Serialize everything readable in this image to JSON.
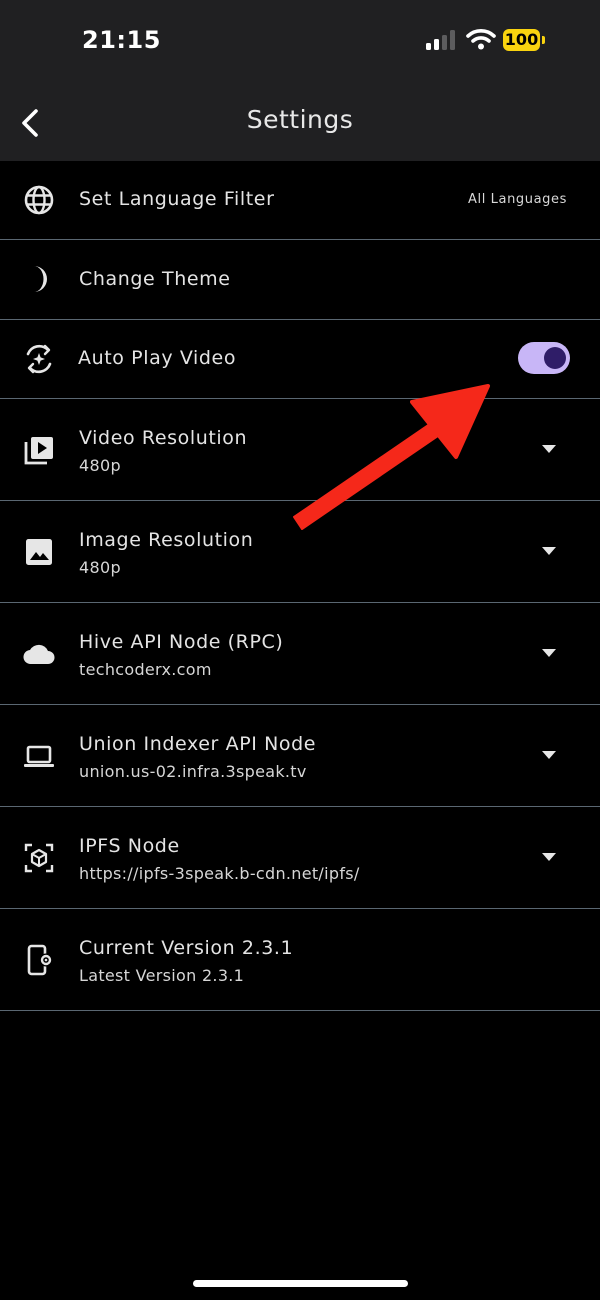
{
  "status_bar": {
    "time": "21:15",
    "battery": "100",
    "battery_color": "#F9D30F"
  },
  "app_bar": {
    "title": "Settings",
    "back_icon": "chevron-left-icon"
  },
  "settings": [
    {
      "icon": "globe-icon",
      "title": "Set Language Filter",
      "value": "All Languages"
    },
    {
      "icon": "moon-icon",
      "title": "Change Theme"
    },
    {
      "icon": "auto-play-icon",
      "title": "Auto Play Video",
      "toggle_on": true
    },
    {
      "icon": "video-library-icon",
      "title": "Video Resolution",
      "subtitle": "480p",
      "dropdown": true
    },
    {
      "icon": "image-icon",
      "title": "Image Resolution",
      "subtitle": "480p",
      "dropdown": true
    },
    {
      "icon": "cloud-icon",
      "title": "Hive API Node (RPC)",
      "subtitle": "techcoderx.com",
      "dropdown": true
    },
    {
      "icon": "laptop-icon",
      "title": "Union Indexer API Node",
      "subtitle": "union.us-02.infra.3speak.tv",
      "dropdown": true
    },
    {
      "icon": "cube-scan-icon",
      "title": "IPFS Node",
      "subtitle": "https://ipfs-3speak.b-cdn.net/ipfs/",
      "dropdown": true
    },
    {
      "icon": "phone-settings-icon",
      "title": "Current Version 2.3.1",
      "subtitle": "Latest Version 2.3.1"
    }
  ],
  "colors": {
    "toggle_track": "#C8B6F7",
    "toggle_knob": "#2F1D68",
    "divider": "#5A6772",
    "annotation_arrow": "#F5281A"
  }
}
